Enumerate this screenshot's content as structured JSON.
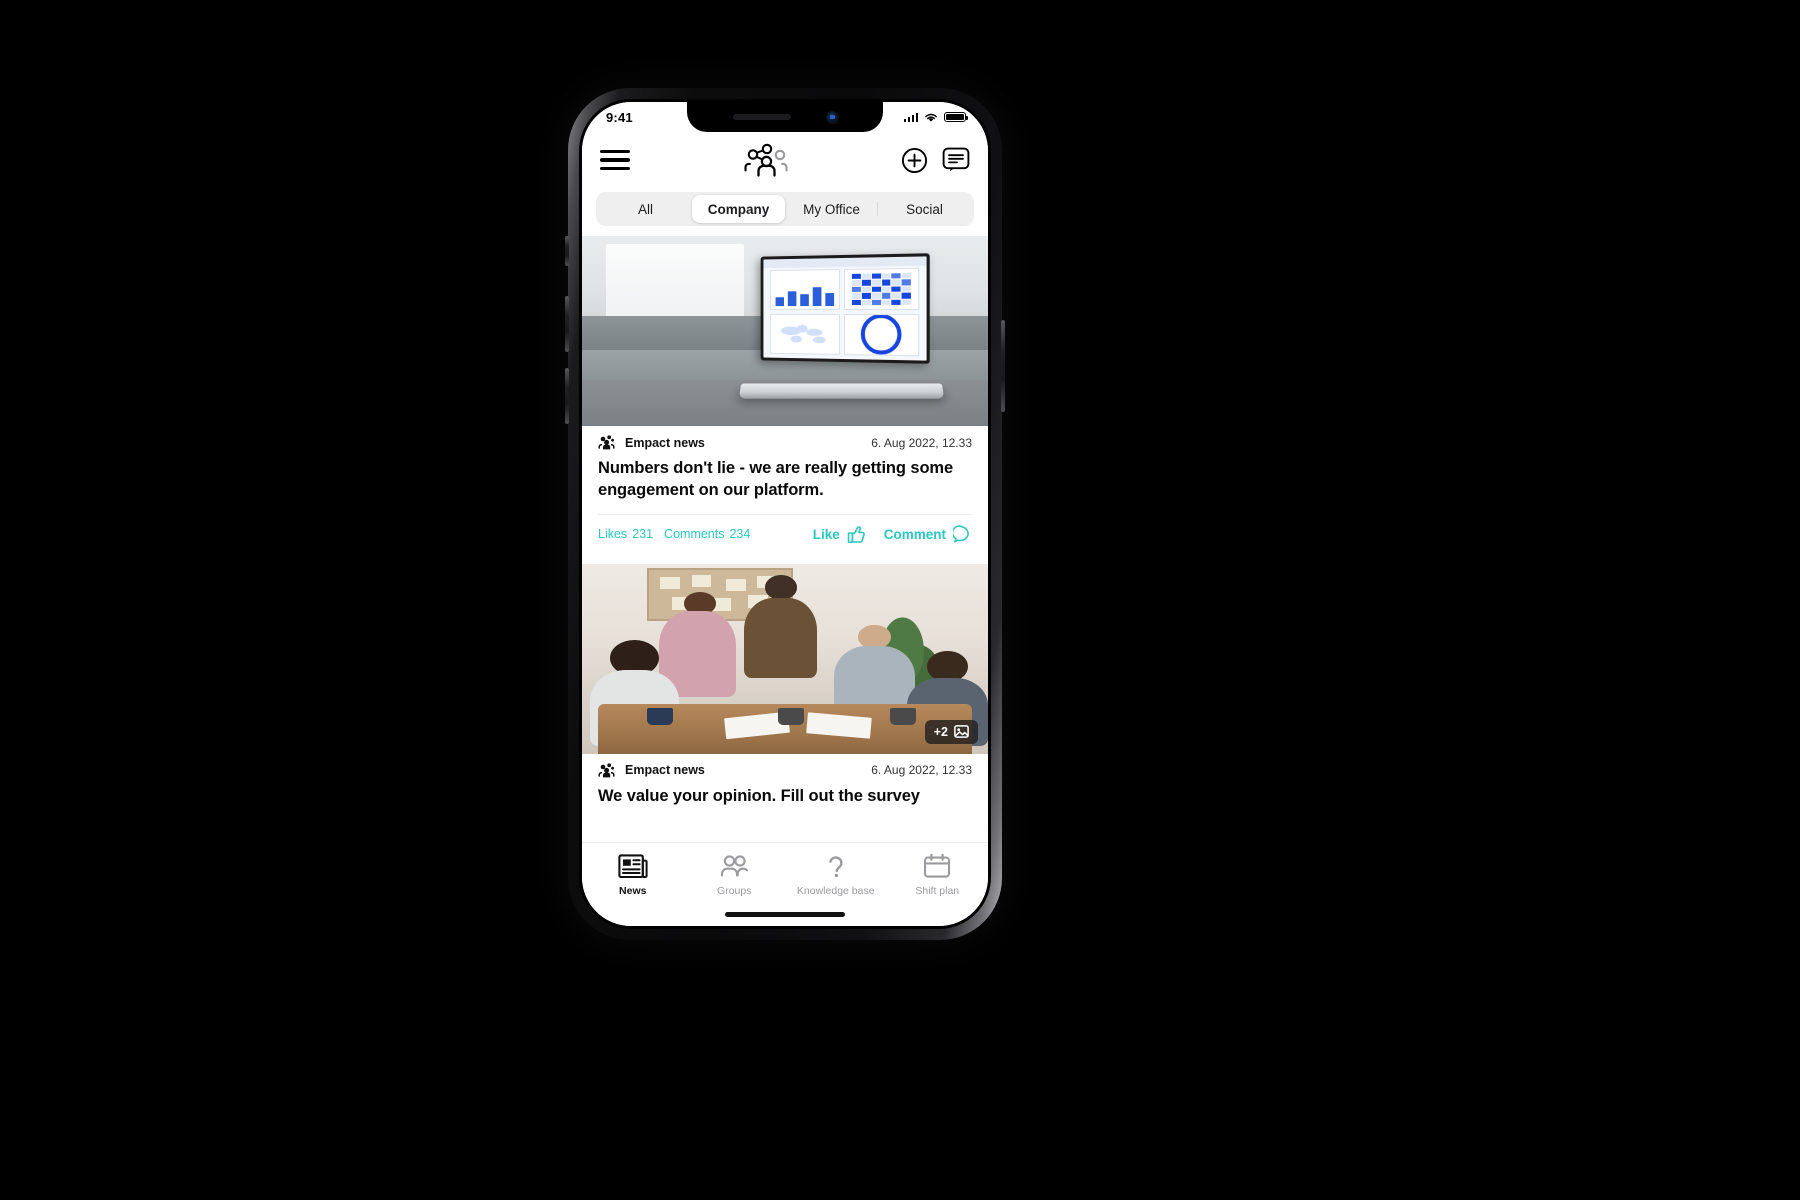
{
  "status_bar": {
    "time": "9:41",
    "signal_icon": "cellular-signal-icon",
    "wifi_icon": "wifi-icon",
    "battery_icon": "battery-full-icon"
  },
  "header": {
    "menu_icon": "hamburger-menu-icon",
    "logo_icon": "empact-people-logo-icon",
    "add_label": "+",
    "add_icon": "plus-circle-icon",
    "chat_icon": "chat-bubble-icon"
  },
  "tabs": [
    {
      "label": "All",
      "active": false
    },
    {
      "label": "Company",
      "active": true
    },
    {
      "label": "My Office",
      "active": false
    },
    {
      "label": "Social",
      "active": false
    }
  ],
  "feed": {
    "posts": [
      {
        "media_type": "laptop-dashboard-photo",
        "author": "Empact news",
        "author_icon": "empact-group-avatar-icon",
        "date": "6. Aug 2022, 12.33",
        "title": "Numbers don't lie - we are really getting some engagement on our platform.",
        "likes_label": "Likes",
        "likes_count": "231",
        "comments_label": "Comments",
        "comments_count": "234",
        "like_action": "Like",
        "like_icon": "thumbs-up-icon",
        "comment_action": "Comment",
        "comment_icon": "comment-bubble-icon"
      },
      {
        "media_type": "team-meeting-photo",
        "author": "Empact news",
        "author_icon": "empact-group-avatar-icon",
        "date": "6. Aug 2022, 12.33",
        "title": "We value your opinion. Fill out the survey",
        "more_images_badge": "+2",
        "more_images_icon": "images-stack-icon"
      }
    ]
  },
  "bottom_nav": [
    {
      "label": "News",
      "icon": "newspaper-icon",
      "active": true
    },
    {
      "label": "Groups",
      "icon": "people-group-icon",
      "active": false
    },
    {
      "label": "Knowledge base",
      "icon": "question-mark-icon",
      "active": false
    },
    {
      "label": "Shift plan",
      "icon": "calendar-icon",
      "active": false
    }
  ],
  "colors": {
    "accent": "#2bc8c0",
    "chart_blue": "#1745e0",
    "tab_track": "#efefef",
    "text_primary": "#0a0a0a",
    "text_muted": "#9b9b9f"
  }
}
